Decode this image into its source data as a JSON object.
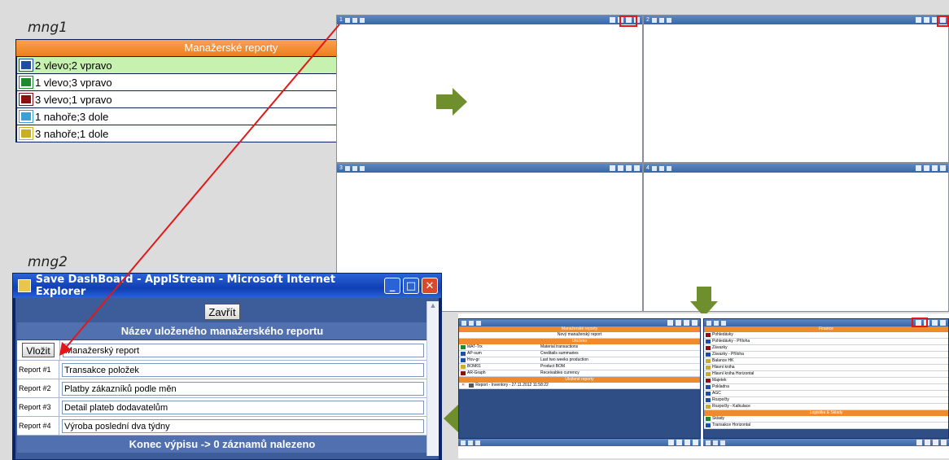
{
  "mng1": {
    "caption": "mng1",
    "header": "Manažerské reporty",
    "items": [
      {
        "label": "2 vlevo;2 vpravo",
        "icon": "layout-2x2-icon",
        "color": "#1f4fa3",
        "selected": true
      },
      {
        "label": "1 vlevo;3 vpravo",
        "icon": "layout-1-3-icon",
        "color": "#1c8a2e",
        "selected": false
      },
      {
        "label": "3 vlevo;1 vpravo",
        "icon": "layout-3-1-icon",
        "color": "#8c1010",
        "selected": false
      },
      {
        "label": "1 nahoře;3 dole",
        "icon": "layout-top-1-icon",
        "color": "#3aa0d8",
        "selected": false
      },
      {
        "label": "3 nahoře;1 dole",
        "icon": "layout-top-3-icon",
        "color": "#c9b020",
        "selected": false
      }
    ]
  },
  "mng2": {
    "caption": "mng2",
    "window_title": "Save DashBoard - ApplStream - Microsoft Internet Explorer",
    "close_label": "Zavřít",
    "section_title": "Název uloženého manažerského reportu",
    "insert_label": "Vložit",
    "insert_value": "Manažerský report",
    "reports": [
      {
        "label": "Report #1",
        "value": "Transakce položek"
      },
      {
        "label": "Report #2",
        "value": "Platby zákazníků podle měn"
      },
      {
        "label": "Report #3",
        "value": "Detail plateb dodavatelům"
      },
      {
        "label": "Report #4",
        "value": "Výroba poslední dva týdny"
      }
    ],
    "footer": "Konec výpisu -> 0 záznamů nalezeno"
  },
  "pane_numbers": [
    "1",
    "2",
    "3",
    "4"
  ],
  "thumb_left": {
    "header1": "Manažerské reporty",
    "new_report": "Nový manažerský report",
    "header2": "Uloženo",
    "rows": [
      {
        "code": "MAT-Trx",
        "desc": "Material transactions"
      },
      {
        "code": "AP-sum",
        "desc": "Creditails summaries"
      },
      {
        "code": "Hov-gr",
        "desc": "Last two weeks production"
      },
      {
        "code": "BOM01",
        "desc": "Product BOM"
      },
      {
        "code": "AR-Graph",
        "desc": "Receivables currency"
      }
    ],
    "header3": "Uložené reporty",
    "saved": "Report - Inventory - 27.11.2012 11:58:22"
  },
  "thumb_right": {
    "header1": "Finance",
    "items": [
      "Pohledávky",
      "Pohledávky - Příloha",
      "Závazky",
      "Závazky - Příloha",
      "Balance HK",
      "Hlavní kniha",
      "Hlavní kniha Horizontal",
      "Majetek",
      "Pokladna",
      "AGC",
      "Rozpočty",
      "Rozpočty - Kalkulace"
    ],
    "header2": "Logistika & Sklady",
    "items2": [
      "Sklady",
      "Transakce Horizontal"
    ]
  },
  "colors": {
    "accent_red": "#e21818",
    "arrow_green": "#6f8f2f",
    "orange": "#ef7e1d",
    "navy": "#0a1f5c"
  }
}
